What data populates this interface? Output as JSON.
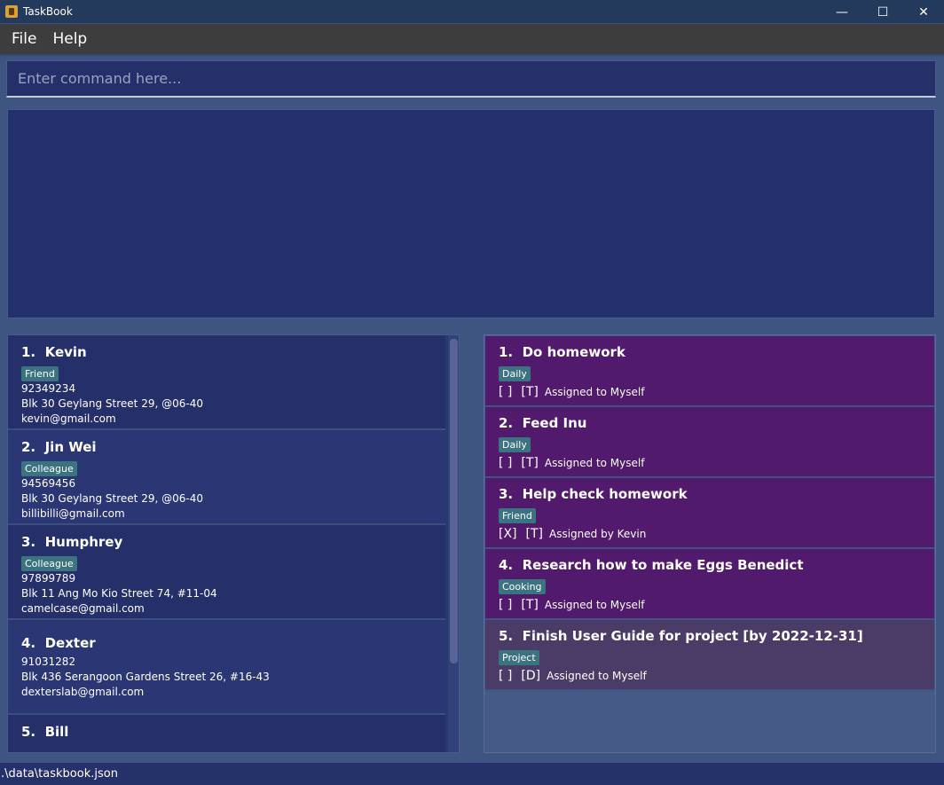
{
  "window": {
    "title": "TaskBook",
    "minimize": "—",
    "maximize": "☐",
    "close": "✕"
  },
  "menu": {
    "file": "File",
    "help": "Help"
  },
  "command": {
    "placeholder": "Enter command here..."
  },
  "persons": [
    {
      "index": "1.",
      "name": "Kevin",
      "tag": "Friend",
      "phone": "92349234",
      "address": "Blk 30 Geylang Street 29, @06-40",
      "email": "kevin@gmail.com"
    },
    {
      "index": "2.",
      "name": "Jin Wei",
      "tag": "Colleague",
      "phone": "94569456",
      "address": "Blk 30 Geylang Street 29, @06-40",
      "email": "billibilli@gmail.com"
    },
    {
      "index": "3.",
      "name": "Humphrey",
      "tag": "Colleague",
      "phone": "97899789",
      "address": "Blk 11 Ang Mo Kio Street 74, #11-04",
      "email": "camelcase@gmail.com"
    },
    {
      "index": "4.",
      "name": "Dexter",
      "phone": "91031282",
      "address": "Blk 436 Serangoon Gardens Street 26, #16-43",
      "email": "dexterslab@gmail.com"
    },
    {
      "index": "5.",
      "name": "Bill"
    }
  ],
  "tasks": [
    {
      "index": "1.",
      "name": "Do homework",
      "tag": "Daily",
      "status": "[  ]",
      "type": "[T]",
      "assignment": "Assigned to  Myself"
    },
    {
      "index": "2.",
      "name": "Feed Inu",
      "tag": "Daily",
      "status": "[  ]",
      "type": "[T]",
      "assignment": "Assigned to  Myself"
    },
    {
      "index": "3.",
      "name": "Help check homework",
      "tag": "Friend",
      "status": "[X]",
      "type": "[T]",
      "assignment": "Assigned by  Kevin"
    },
    {
      "index": "4.",
      "name": "Research how to make Eggs Benedict",
      "tag": "Cooking",
      "status": "[  ]",
      "type": "[T]",
      "assignment": "Assigned to  Myself"
    },
    {
      "index": "5.",
      "name": "Finish User Guide for project [by 2022-12-31]",
      "tag": "Project",
      "status": "[  ]",
      "type": "[D]",
      "assignment": "Assigned to  Myself"
    }
  ],
  "status": {
    "path": ".\\data\\taskbook.json"
  }
}
